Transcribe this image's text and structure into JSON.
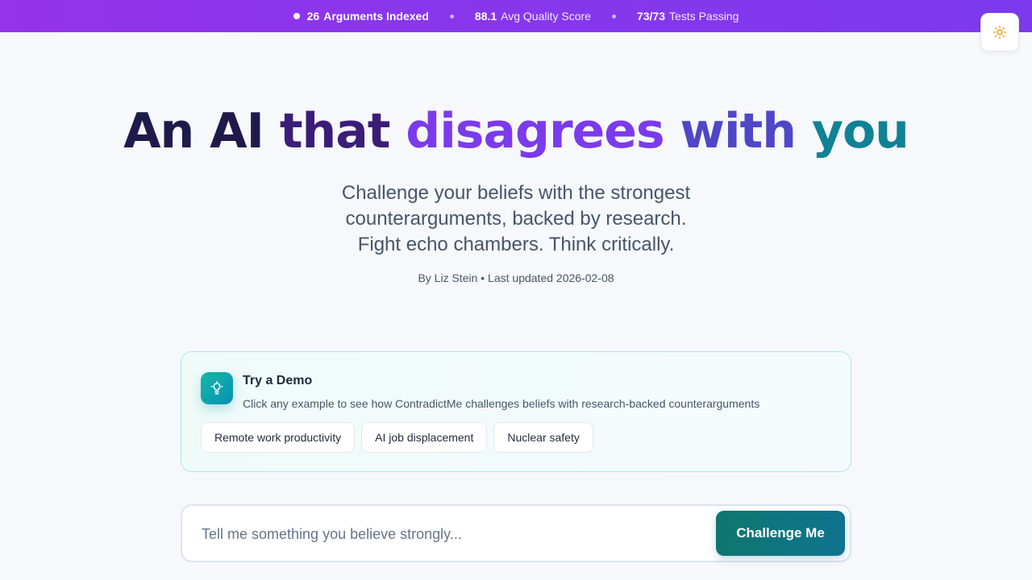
{
  "stats_bar": {
    "items": [
      {
        "value": "26",
        "label": "Arguments Indexed"
      },
      {
        "value": "88.1",
        "label": "Avg Quality Score"
      },
      {
        "value": "73/73",
        "label": "Tests Passing"
      }
    ]
  },
  "theme_toggle": {
    "icon": "sun-icon"
  },
  "hero": {
    "title_parts": [
      "An",
      "AI",
      "that",
      "disagrees",
      "with",
      "you"
    ],
    "subtitle_lines": [
      "Challenge your beliefs with the strongest",
      "counterarguments, backed by research.",
      "Fight echo chambers. Think critically."
    ],
    "byline": "By Liz Stein • Last updated 2026-02-08"
  },
  "demo": {
    "icon": "lightbulb-icon",
    "title": "Try a Demo",
    "description": "Click any example to see how ContradictMe challenges beliefs with research-backed counterarguments",
    "examples": [
      "Remote work productivity",
      "AI job displacement",
      "Nuclear safety"
    ]
  },
  "input": {
    "placeholder": "Tell me something you believe strongly...",
    "value": "",
    "button_label": "Challenge Me"
  },
  "colors": {
    "banner": "#9333ea",
    "accent_teal": "#0f766e",
    "title_purple": "#7c3aed"
  }
}
